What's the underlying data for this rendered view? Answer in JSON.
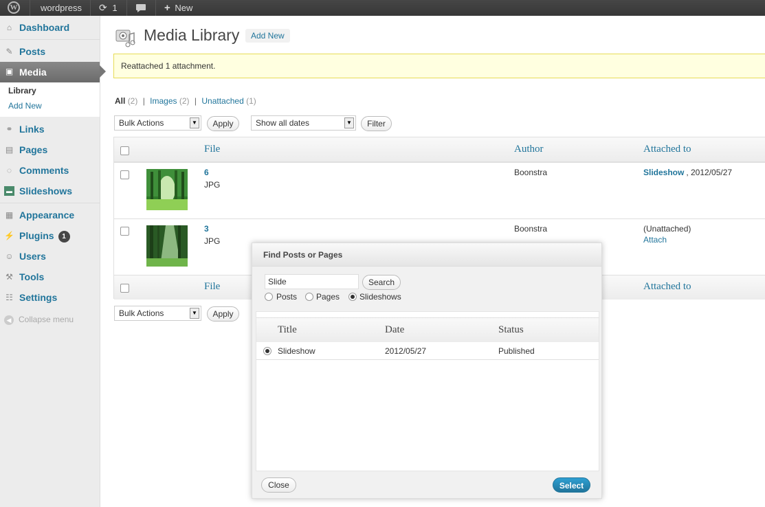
{
  "adminbar": {
    "site": "wordpress",
    "updates": "1",
    "new": "New"
  },
  "sidebar": {
    "items": [
      {
        "label": "Dashboard",
        "icon": "dashboard-icon"
      },
      {
        "label": "Posts",
        "icon": "pushpin-icon"
      },
      {
        "label": "Media",
        "icon": "media-icon"
      },
      {
        "label": "Links",
        "icon": "link-icon"
      },
      {
        "label": "Pages",
        "icon": "pages-icon"
      },
      {
        "label": "Comments",
        "icon": "comment-icon"
      },
      {
        "label": "Slideshows",
        "icon": "slideshow-icon"
      },
      {
        "label": "Appearance",
        "icon": "appearance-icon"
      },
      {
        "label": "Plugins",
        "icon": "plugin-icon",
        "badge": "1"
      },
      {
        "label": "Users",
        "icon": "users-icon"
      },
      {
        "label": "Tools",
        "icon": "tools-icon"
      },
      {
        "label": "Settings",
        "icon": "settings-icon"
      }
    ],
    "submenu": {
      "library": "Library",
      "add_new": "Add New"
    },
    "collapse": "Collapse menu"
  },
  "page": {
    "title": "Media Library",
    "add_new": "Add New",
    "notice": "Reattached 1 attachment."
  },
  "filters": {
    "all": "All",
    "all_count": "(2)",
    "images": "Images",
    "images_count": "(2)",
    "unattached": "Unattached",
    "unattached_count": "(1)",
    "sep": "|"
  },
  "actions": {
    "bulk": "Bulk Actions",
    "apply": "Apply",
    "dates": "Show all dates",
    "filter": "Filter"
  },
  "table": {
    "columns": {
      "file": "File",
      "author": "Author",
      "attached": "Attached to"
    },
    "rows": [
      {
        "name": "6",
        "type": "JPG",
        "author": "Boonstra",
        "attached_link": "Slideshow",
        "attached_date": ", 2012/05/27"
      },
      {
        "name": "3",
        "type": "JPG",
        "author": "Boonstra",
        "attached_text": "(Unattached)",
        "attach_link": "Attach"
      }
    ]
  },
  "modal": {
    "title": "Find Posts or Pages",
    "search_value": "Slide",
    "search_button": "Search",
    "types": [
      "Posts",
      "Pages",
      "Slideshows"
    ],
    "selected_type": "Slideshows",
    "columns": {
      "title": "Title",
      "date": "Date",
      "status": "Status"
    },
    "results": [
      {
        "title": "Slideshow",
        "date": "2012/05/27",
        "status": "Published"
      }
    ],
    "close": "Close",
    "select": "Select"
  },
  "colors": {
    "link": "#21759b",
    "notice_bg": "#ffffe0",
    "menu_current": "#777777",
    "primary_button": "#21759b"
  }
}
